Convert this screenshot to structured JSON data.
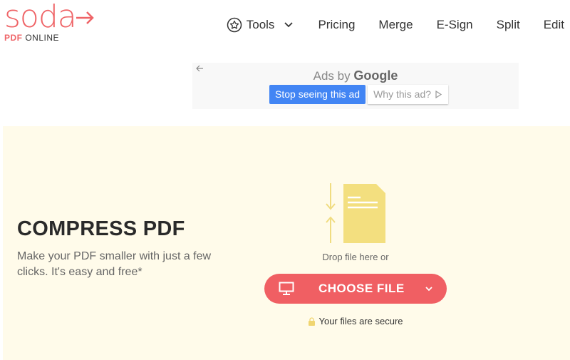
{
  "logo": {
    "word": "soda",
    "pdf": "PDF",
    "online": "ONLINE"
  },
  "nav": {
    "items": [
      {
        "label": "Tools",
        "icon": "star-icon",
        "dropdown": true
      },
      {
        "label": "Pricing"
      },
      {
        "label": "Merge"
      },
      {
        "label": "E-Sign"
      },
      {
        "label": "Split"
      },
      {
        "label": "Edit"
      }
    ]
  },
  "ad": {
    "ads_by": "Ads by",
    "brand": "Google",
    "stop_label": "Stop seeing this ad",
    "why_label": "Why this ad?"
  },
  "hero": {
    "title": "COMPRESS PDF",
    "description": "Make your PDF smaller with just a few clicks. It's easy and free*",
    "drop_text": "Drop file here or",
    "choose_label": "CHOOSE FILE",
    "secure_text": "Your files are secure"
  },
  "colors": {
    "brand": "#ef6467",
    "button": "#f05f63",
    "hero_bg": "#fffbea",
    "doc": "#f3df7f",
    "ad_blue": "#4285f4"
  }
}
